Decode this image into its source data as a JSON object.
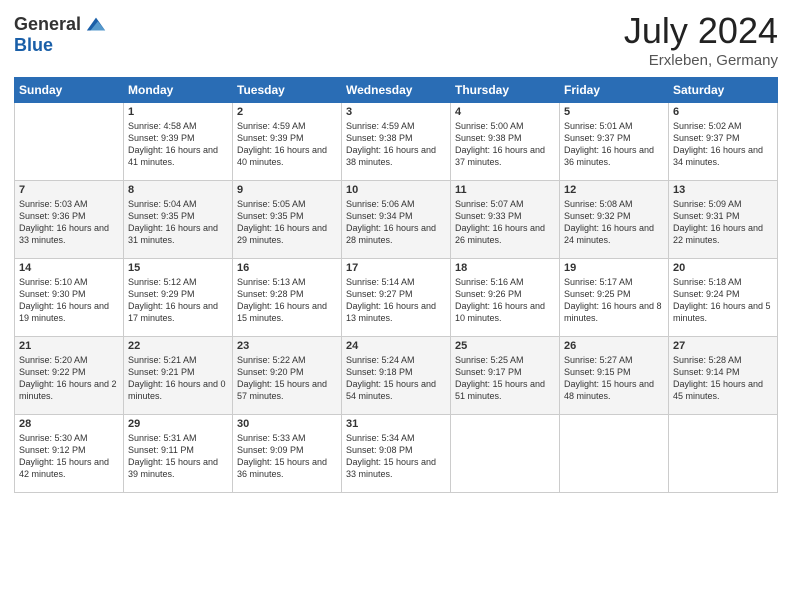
{
  "header": {
    "logo_general": "General",
    "logo_blue": "Blue",
    "month": "July 2024",
    "location": "Erxleben, Germany"
  },
  "weekdays": [
    "Sunday",
    "Monday",
    "Tuesday",
    "Wednesday",
    "Thursday",
    "Friday",
    "Saturday"
  ],
  "weeks": [
    [
      {
        "day": "",
        "sunrise": "",
        "sunset": "",
        "daylight": ""
      },
      {
        "day": "1",
        "sunrise": "Sunrise: 4:58 AM",
        "sunset": "Sunset: 9:39 PM",
        "daylight": "Daylight: 16 hours and 41 minutes."
      },
      {
        "day": "2",
        "sunrise": "Sunrise: 4:59 AM",
        "sunset": "Sunset: 9:39 PM",
        "daylight": "Daylight: 16 hours and 40 minutes."
      },
      {
        "day": "3",
        "sunrise": "Sunrise: 4:59 AM",
        "sunset": "Sunset: 9:38 PM",
        "daylight": "Daylight: 16 hours and 38 minutes."
      },
      {
        "day": "4",
        "sunrise": "Sunrise: 5:00 AM",
        "sunset": "Sunset: 9:38 PM",
        "daylight": "Daylight: 16 hours and 37 minutes."
      },
      {
        "day": "5",
        "sunrise": "Sunrise: 5:01 AM",
        "sunset": "Sunset: 9:37 PM",
        "daylight": "Daylight: 16 hours and 36 minutes."
      },
      {
        "day": "6",
        "sunrise": "Sunrise: 5:02 AM",
        "sunset": "Sunset: 9:37 PM",
        "daylight": "Daylight: 16 hours and 34 minutes."
      }
    ],
    [
      {
        "day": "7",
        "sunrise": "Sunrise: 5:03 AM",
        "sunset": "Sunset: 9:36 PM",
        "daylight": "Daylight: 16 hours and 33 minutes."
      },
      {
        "day": "8",
        "sunrise": "Sunrise: 5:04 AM",
        "sunset": "Sunset: 9:35 PM",
        "daylight": "Daylight: 16 hours and 31 minutes."
      },
      {
        "day": "9",
        "sunrise": "Sunrise: 5:05 AM",
        "sunset": "Sunset: 9:35 PM",
        "daylight": "Daylight: 16 hours and 29 minutes."
      },
      {
        "day": "10",
        "sunrise": "Sunrise: 5:06 AM",
        "sunset": "Sunset: 9:34 PM",
        "daylight": "Daylight: 16 hours and 28 minutes."
      },
      {
        "day": "11",
        "sunrise": "Sunrise: 5:07 AM",
        "sunset": "Sunset: 9:33 PM",
        "daylight": "Daylight: 16 hours and 26 minutes."
      },
      {
        "day": "12",
        "sunrise": "Sunrise: 5:08 AM",
        "sunset": "Sunset: 9:32 PM",
        "daylight": "Daylight: 16 hours and 24 minutes."
      },
      {
        "day": "13",
        "sunrise": "Sunrise: 5:09 AM",
        "sunset": "Sunset: 9:31 PM",
        "daylight": "Daylight: 16 hours and 22 minutes."
      }
    ],
    [
      {
        "day": "14",
        "sunrise": "Sunrise: 5:10 AM",
        "sunset": "Sunset: 9:30 PM",
        "daylight": "Daylight: 16 hours and 19 minutes."
      },
      {
        "day": "15",
        "sunrise": "Sunrise: 5:12 AM",
        "sunset": "Sunset: 9:29 PM",
        "daylight": "Daylight: 16 hours and 17 minutes."
      },
      {
        "day": "16",
        "sunrise": "Sunrise: 5:13 AM",
        "sunset": "Sunset: 9:28 PM",
        "daylight": "Daylight: 16 hours and 15 minutes."
      },
      {
        "day": "17",
        "sunrise": "Sunrise: 5:14 AM",
        "sunset": "Sunset: 9:27 PM",
        "daylight": "Daylight: 16 hours and 13 minutes."
      },
      {
        "day": "18",
        "sunrise": "Sunrise: 5:16 AM",
        "sunset": "Sunset: 9:26 PM",
        "daylight": "Daylight: 16 hours and 10 minutes."
      },
      {
        "day": "19",
        "sunrise": "Sunrise: 5:17 AM",
        "sunset": "Sunset: 9:25 PM",
        "daylight": "Daylight: 16 hours and 8 minutes."
      },
      {
        "day": "20",
        "sunrise": "Sunrise: 5:18 AM",
        "sunset": "Sunset: 9:24 PM",
        "daylight": "Daylight: 16 hours and 5 minutes."
      }
    ],
    [
      {
        "day": "21",
        "sunrise": "Sunrise: 5:20 AM",
        "sunset": "Sunset: 9:22 PM",
        "daylight": "Daylight: 16 hours and 2 minutes."
      },
      {
        "day": "22",
        "sunrise": "Sunrise: 5:21 AM",
        "sunset": "Sunset: 9:21 PM",
        "daylight": "Daylight: 16 hours and 0 minutes."
      },
      {
        "day": "23",
        "sunrise": "Sunrise: 5:22 AM",
        "sunset": "Sunset: 9:20 PM",
        "daylight": "Daylight: 15 hours and 57 minutes."
      },
      {
        "day": "24",
        "sunrise": "Sunrise: 5:24 AM",
        "sunset": "Sunset: 9:18 PM",
        "daylight": "Daylight: 15 hours and 54 minutes."
      },
      {
        "day": "25",
        "sunrise": "Sunrise: 5:25 AM",
        "sunset": "Sunset: 9:17 PM",
        "daylight": "Daylight: 15 hours and 51 minutes."
      },
      {
        "day": "26",
        "sunrise": "Sunrise: 5:27 AM",
        "sunset": "Sunset: 9:15 PM",
        "daylight": "Daylight: 15 hours and 48 minutes."
      },
      {
        "day": "27",
        "sunrise": "Sunrise: 5:28 AM",
        "sunset": "Sunset: 9:14 PM",
        "daylight": "Daylight: 15 hours and 45 minutes."
      }
    ],
    [
      {
        "day": "28",
        "sunrise": "Sunrise: 5:30 AM",
        "sunset": "Sunset: 9:12 PM",
        "daylight": "Daylight: 15 hours and 42 minutes."
      },
      {
        "day": "29",
        "sunrise": "Sunrise: 5:31 AM",
        "sunset": "Sunset: 9:11 PM",
        "daylight": "Daylight: 15 hours and 39 minutes."
      },
      {
        "day": "30",
        "sunrise": "Sunrise: 5:33 AM",
        "sunset": "Sunset: 9:09 PM",
        "daylight": "Daylight: 15 hours and 36 minutes."
      },
      {
        "day": "31",
        "sunrise": "Sunrise: 5:34 AM",
        "sunset": "Sunset: 9:08 PM",
        "daylight": "Daylight: 15 hours and 33 minutes."
      },
      {
        "day": "",
        "sunrise": "",
        "sunset": "",
        "daylight": ""
      },
      {
        "day": "",
        "sunrise": "",
        "sunset": "",
        "daylight": ""
      },
      {
        "day": "",
        "sunrise": "",
        "sunset": "",
        "daylight": ""
      }
    ]
  ]
}
